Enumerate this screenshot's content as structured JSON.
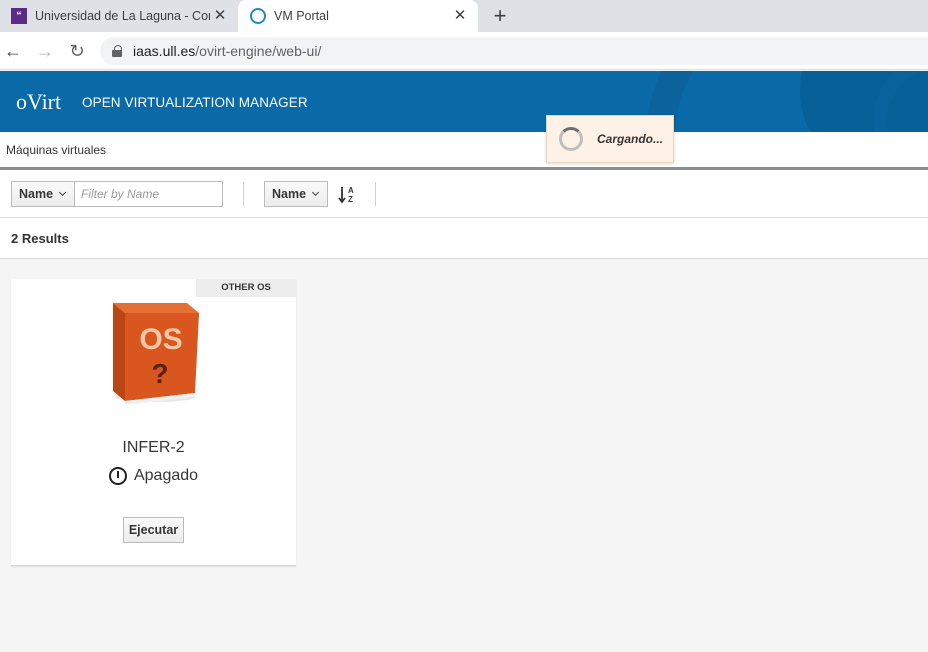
{
  "browser": {
    "tabs": [
      {
        "title": "Universidad de La Laguna - Cont",
        "favicon": "university-favicon",
        "favicon_glyph": "“"
      },
      {
        "title": "VM Portal",
        "favicon": "ovirt-favicon"
      }
    ],
    "new_tab_glyph": "+",
    "close_glyph": "✕",
    "url_host": "iaas.ull.es",
    "url_path": "/ovirt-engine/web-ui/"
  },
  "header": {
    "brand": "oVirt",
    "title": "OPEN VIRTUALIZATION MANAGER",
    "color": "#0a6aa7"
  },
  "breadcrumb": "Máquinas virtuales",
  "toolbar": {
    "filter_field": "Name",
    "filter_placeholder": "Filter by Name",
    "sort_field": "Name",
    "sort_icon": "sort-alpha-asc-icon"
  },
  "results": {
    "count_label": "2 Results"
  },
  "vms": [
    {
      "os_badge": "OTHER OS",
      "os_image_text": "OS",
      "os_image_question": "?",
      "name": "INFER-2",
      "status": "Apagado",
      "action": "Ejecutar"
    }
  ],
  "loading": {
    "text": "Cargando..."
  }
}
